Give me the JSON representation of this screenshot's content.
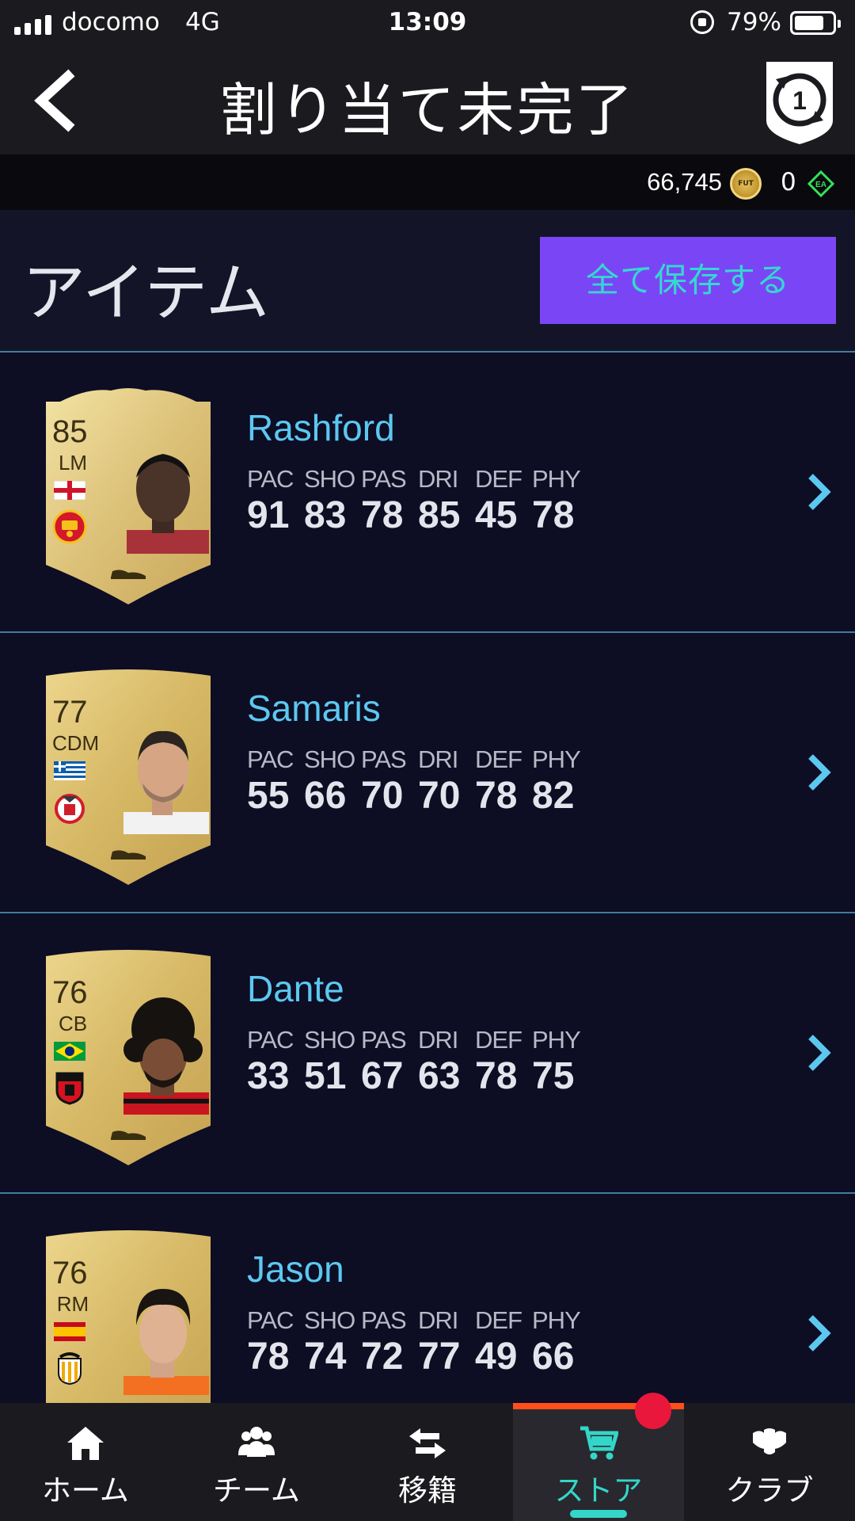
{
  "status_bar": {
    "carrier": "docomo",
    "network": "4G",
    "time": "13:09",
    "battery": "79%",
    "battery_level": 0.79
  },
  "header": {
    "title": "割り当て未完了"
  },
  "currency": {
    "coins": "66,745",
    "coin_label": "FUT",
    "points": "0"
  },
  "section": {
    "title": "アイテム",
    "save_all_label": "全て保存する"
  },
  "stat_labels": [
    "PAC",
    "SHO",
    "PAS",
    "DRI",
    "DEF",
    "PHY"
  ],
  "players": [
    {
      "name": "Rashford",
      "rating": "85",
      "position": "LM",
      "stats": [
        "91",
        "83",
        "78",
        "85",
        "45",
        "78"
      ],
      "nation": "england",
      "club": "manchester-united"
    },
    {
      "name": "Samaris",
      "rating": "77",
      "position": "CDM",
      "stats": [
        "55",
        "66",
        "70",
        "70",
        "78",
        "82"
      ],
      "nation": "greece",
      "club": "benfica"
    },
    {
      "name": "Dante",
      "rating": "76",
      "position": "CB",
      "stats": [
        "33",
        "51",
        "67",
        "63",
        "78",
        "75"
      ],
      "nation": "brazil",
      "club": "nice"
    },
    {
      "name": "Jason",
      "rating": "76",
      "position": "RM",
      "stats": [
        "78",
        "74",
        "72",
        "77",
        "49",
        "66"
      ],
      "nation": "spain",
      "club": "valencia"
    }
  ],
  "tabs": [
    {
      "label": "ホーム",
      "icon": "home-icon"
    },
    {
      "label": "チーム",
      "icon": "team-icon"
    },
    {
      "label": "移籍",
      "icon": "transfer-icon"
    },
    {
      "label": "ストア",
      "icon": "cart-icon",
      "active": true
    },
    {
      "label": "クラブ",
      "icon": "club-icon"
    }
  ],
  "colors": {
    "accent_cyan": "#5cc8f0",
    "button_purple": "#7a46f5",
    "active_tab": "#34d6c9",
    "active_tab_bar": "#ff4e1a",
    "notification": "#e8173b"
  }
}
